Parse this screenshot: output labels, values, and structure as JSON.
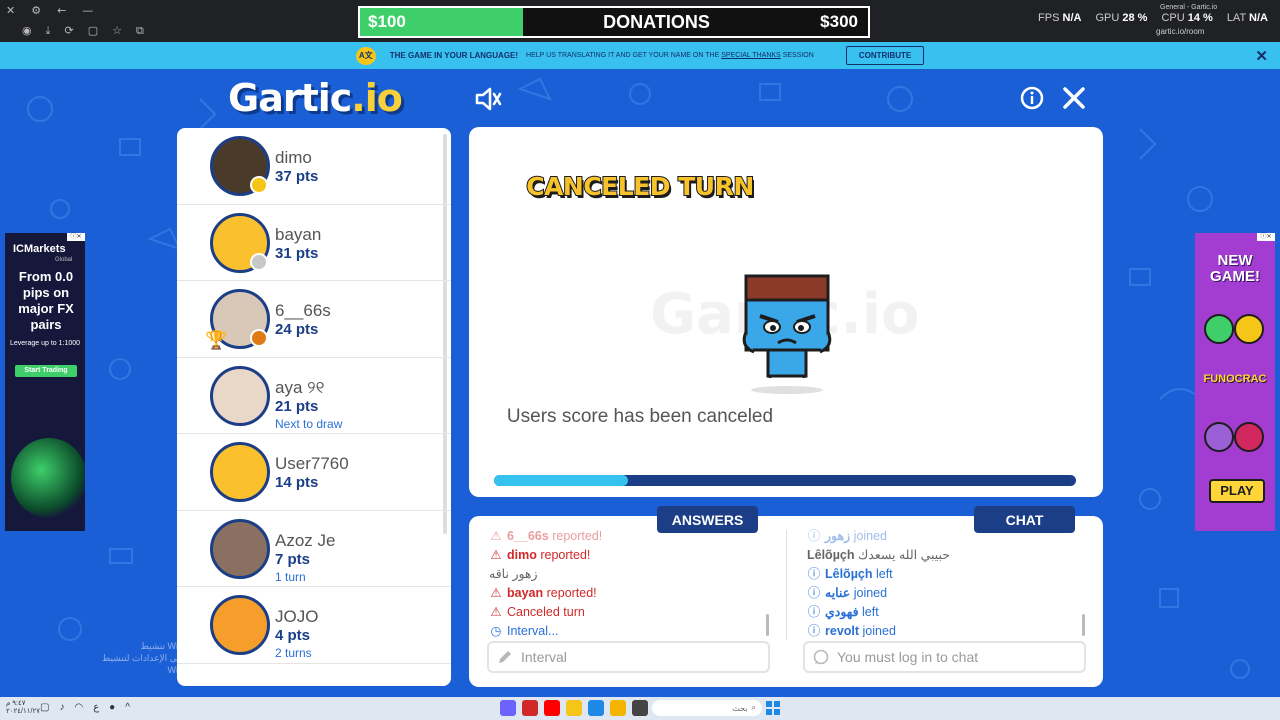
{
  "browser": {
    "tab_title": "General - Gartic.io",
    "url": "gartic.io/room"
  },
  "donation": {
    "current": "$100",
    "label": "DONATIONS",
    "goal": "$300",
    "progress": 0.32
  },
  "stats": {
    "fps_label": "FPS",
    "fps_value": "N/A",
    "gpu_label": "GPU",
    "gpu_value": "28 %",
    "cpu_label": "CPU",
    "cpu_value": "14 %",
    "lat_label": "LAT",
    "lat_value": "N/A"
  },
  "banner": {
    "title": "THE GAME IN YOUR LANGUAGE!",
    "text_before": "HELP US TRANSLATING IT AND GET YOUR NAME ON THE",
    "link": "SPECIAL THANKS",
    "text_after": "SESSION",
    "button": "CONTRIBUTE",
    "close": "✕"
  },
  "logo": {
    "main": "Gartic",
    "suffix": ".io"
  },
  "players": [
    {
      "name": "dimo",
      "pts": "37 pts",
      "sub": "",
      "status_color": "#f5c518",
      "avatar_color": "#4a3a2a"
    },
    {
      "name": "bayan",
      "pts": "31 pts",
      "sub": "",
      "status_color": "#c8c8c8",
      "avatar_color": "#fbc02d"
    },
    {
      "name": "6__66s",
      "pts": "24 pts",
      "sub": "",
      "status_color": "#e07b14",
      "avatar_color": "#d9c7b8",
      "trophy": true
    },
    {
      "name": "aya ୨୧",
      "pts": "21 pts",
      "sub": "Next to draw",
      "status_color": "",
      "avatar_color": "#e8d8c8"
    },
    {
      "name": "User7760",
      "pts": "14 pts",
      "sub": "",
      "status_color": "",
      "avatar_color": "#fbc02d"
    },
    {
      "name": "Azoz Je",
      "pts": "7 pts",
      "sub": "1 turn",
      "status_color": "",
      "avatar_color": "#8a7060"
    },
    {
      "name": "JOJO",
      "pts": "4 pts",
      "sub": "2 turns",
      "status_color": "",
      "avatar_color": "#f59e2c"
    }
  ],
  "main": {
    "title": "CANCELED TURN",
    "watermark": "Gartic.io",
    "message": "Users score has been canceled",
    "timer_progress": 0.23
  },
  "tabs": {
    "answers": "ANSWERS",
    "chat": "CHAT"
  },
  "answers_log": [
    {
      "type": "red",
      "icon": "⚠",
      "user": "6__66s",
      "text": "reported!",
      "faded": true
    },
    {
      "type": "red",
      "icon": "⚠",
      "user": "dimo",
      "text": "reported!"
    },
    {
      "type": "gray",
      "icon": "",
      "user": "",
      "text": "زهور ناقه"
    },
    {
      "type": "red",
      "icon": "⚠",
      "user": "bayan",
      "text": "reported!"
    },
    {
      "type": "red",
      "icon": "⚠",
      "user": "",
      "text": "Canceled turn"
    },
    {
      "type": "blue",
      "icon": "◷",
      "user": "",
      "text": "Interval..."
    }
  ],
  "chat_log": [
    {
      "type": "blue",
      "icon": "ⓘ",
      "user": "زهور",
      "text": "joined",
      "faded": true
    },
    {
      "type": "gray",
      "icon": "",
      "user": "Lêlõµçh",
      "text": "حبيبي الله يسعدك"
    },
    {
      "type": "blue",
      "icon": "ⓘ",
      "user": "Lêlõµçh",
      "text": "left"
    },
    {
      "type": "blue",
      "icon": "ⓘ",
      "user": "عنايه",
      "text": "joined"
    },
    {
      "type": "blue",
      "icon": "ⓘ",
      "user": "فهودي",
      "text": "left"
    },
    {
      "type": "blue",
      "icon": "ⓘ",
      "user": "revolt",
      "text": "joined"
    }
  ],
  "inputs": {
    "answer_placeholder": "Interval",
    "chat_placeholder": "You must log in to chat"
  },
  "ad_left": {
    "brand": "ICMarkets",
    "brand_sub": "Global",
    "headline": "From 0.0 pips on major FX pairs",
    "leverage": "Leverage up to 1:1000",
    "cta": "Start Trading"
  },
  "ad_right": {
    "headline": "NEW GAME!",
    "brand": "FUNOCRAC",
    "cta": "PLAY"
  },
  "windows_watermark": {
    "line1": "تنشيط Windows",
    "line2": "انتقل إلى الإعدادات لتنشيط Windows"
  },
  "taskbar": {
    "time": "٩:٤٧ م",
    "date": "٢٠٢٤/١١/٢٧",
    "search_placeholder": "بحث"
  }
}
